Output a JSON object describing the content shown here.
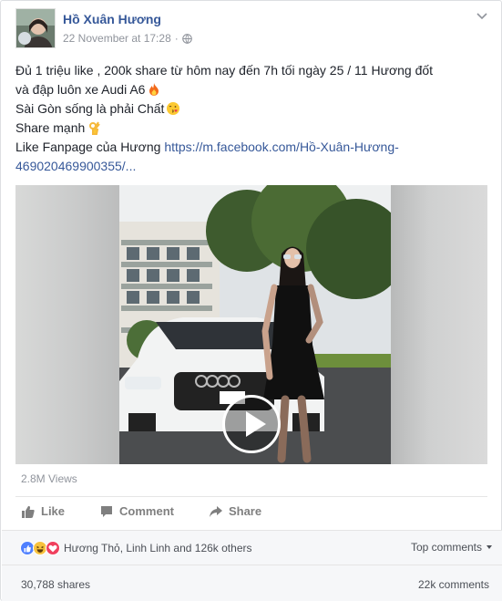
{
  "post": {
    "author": "Hồ Xuân Hương",
    "timestamp": "22 November at 17:28",
    "separator": "·",
    "privacy_icon": "globe-icon",
    "body_lines": [
      "Đủ 1 triệu like , 200k share từ hôm nay đến 7h tối ngày 25 / 11 Hương đốt",
      "và đập luôn xe Audi A6",
      "Sài Gòn sống là phải Chất",
      "Share mạnh",
      "Like Fanpage của Hương "
    ],
    "link_text_1": "https://m.facebook.com/Hồ-Xuân-Hương-",
    "link_text_2": "469020469900355/..."
  },
  "video": {
    "views": "2.8M Views"
  },
  "actions": {
    "like": "Like",
    "comment": "Comment",
    "share": "Share"
  },
  "reactions": {
    "names": "Hương Thỏ, Linh Linh and 126k others",
    "top_comments": "Top comments",
    "colors": {
      "like": "#4f80ff",
      "haha": "#f7c23e",
      "love": "#f0405e"
    }
  },
  "stats": {
    "shares": "30,788 shares",
    "comments": "22k comments"
  },
  "colors": {
    "link": "#365899",
    "muted": "#90949c"
  }
}
